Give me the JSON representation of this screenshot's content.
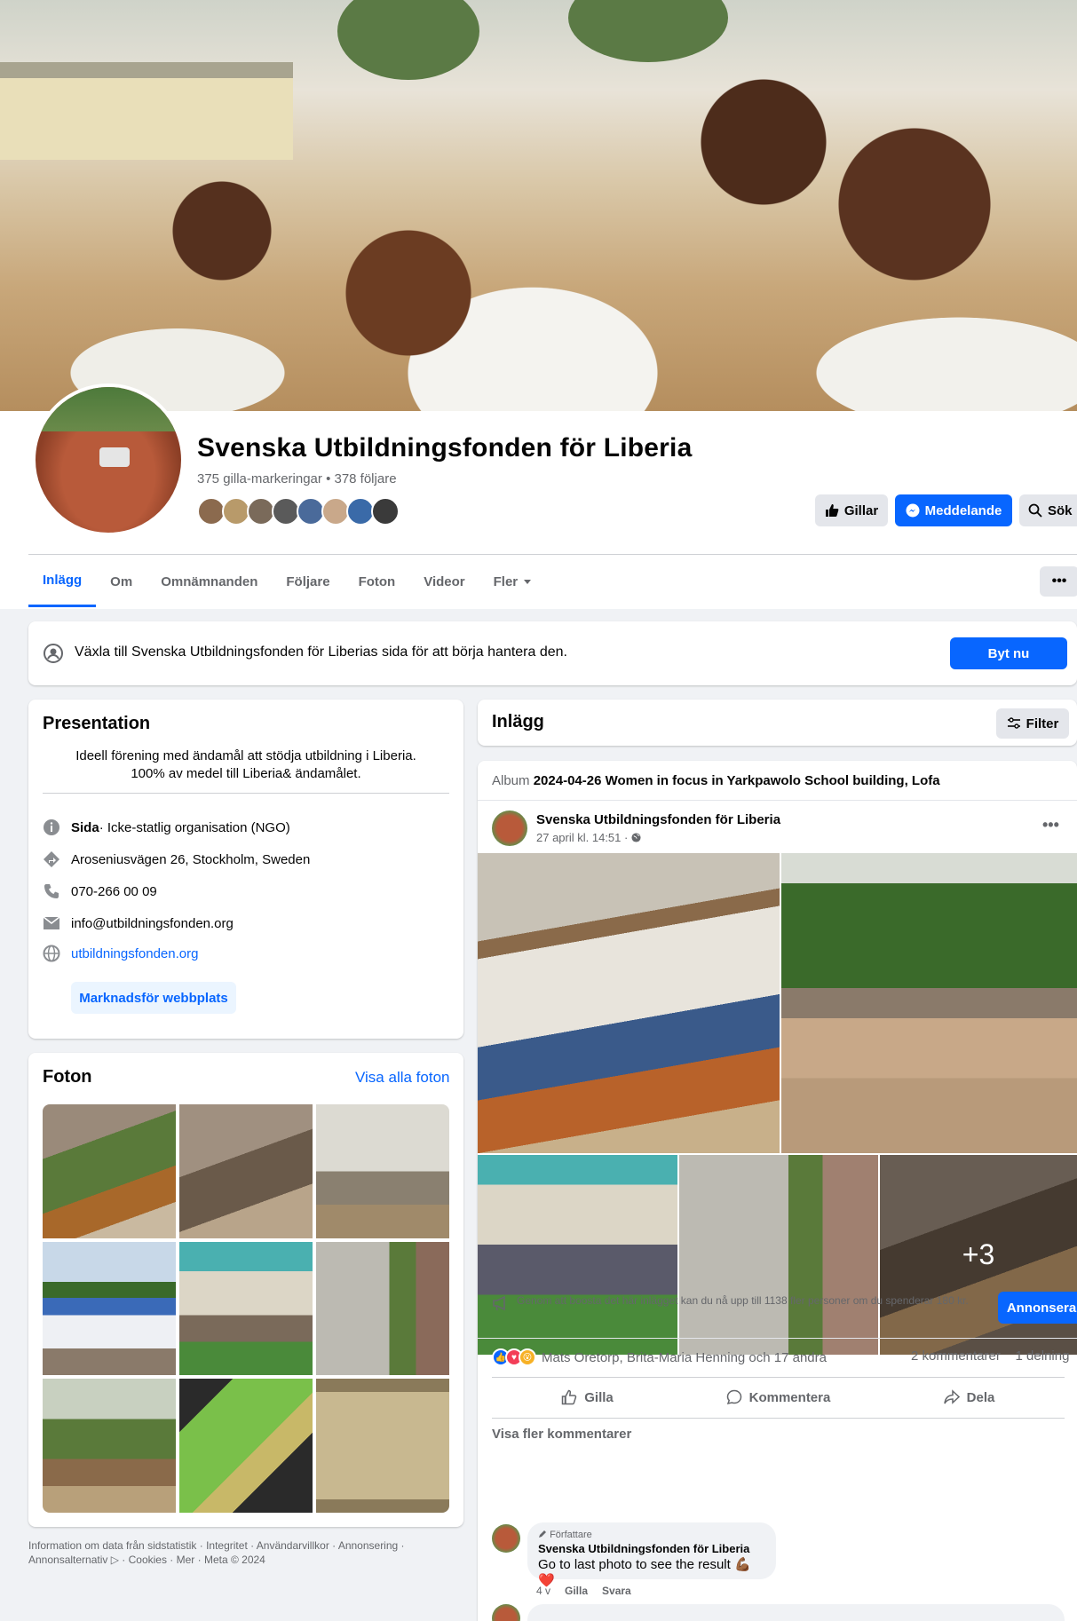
{
  "page": {
    "name": "Svenska Utbildningsfonden för Liberia",
    "stats": "375 gilla-markeringar • 378 följare"
  },
  "header_buttons": {
    "like": "Gillar",
    "message": "Meddelande",
    "search": "Sök"
  },
  "tabs": [
    "Inlägg",
    "Om",
    "Omnämnanden",
    "Följare",
    "Foton",
    "Videor",
    "Fler"
  ],
  "switch_banner": {
    "text": "Växla till Svenska Utbildningsfonden för Liberias sida för att börja hantera den.",
    "button": "Byt nu"
  },
  "presentation": {
    "title": "Presentation",
    "description_line1": "Ideell förening med ändamål att stödja utbildning i Liberia.",
    "description_line2": "100% av medel till Liberia& ändamålet.",
    "category_label": "Sida",
    "category_value": " · Icke-statlig organisation (NGO)",
    "address": "Aroseniusvägen 26, Stockholm, Sweden",
    "phone": "070-266 00 09",
    "email": "info@utbildningsfonden.org",
    "website": "utbildningsfonden.org",
    "promote_button": "Marknadsför webbplats"
  },
  "photos_card": {
    "title": "Foton",
    "link": "Visa alla foton"
  },
  "footer": {
    "line1": "Information om data från sidstatistik · Integritet · Användarvillkor · Annonsering ·",
    "line2": "Annonsalternativ ▷ · Cookies · Mer · Meta © 2024"
  },
  "posts_section": {
    "title": "Inlägg",
    "filter": "Filter"
  },
  "post": {
    "album_prefix": "Album",
    "album_title": "2024-04-26 Women in focus in Yarkpawolo School building, Lofa",
    "author": "Svenska Utbildningsfonden för Liberia",
    "time": "27 april kl. 14:51 · ",
    "more_count": "+3",
    "boost_text": "Genom att boosta det här inlägget kan du nå upp till 1138 fler personer om du spenderar 180 kr.",
    "boost_button": "Annonsera",
    "reactions_text": "Mats Oretorp, Brita-Maria Henning och 17 andra",
    "comments_count": "2 kommentarer",
    "shares_count": "1 delning",
    "action_like": "Gilla",
    "action_comment": "Kommentera",
    "action_share": "Dela",
    "more_comments": "Visa fler kommentarer"
  },
  "comment": {
    "badge": "Författare",
    "author": "Svenska Utbildningsfonden för Liberia",
    "text": "Go to last photo to see the result 💪🏾❤️",
    "age": "4 v",
    "like": "Gilla",
    "reply": "Svara"
  },
  "colors": {
    "accent": "#0866ff",
    "text_secondary": "#65676b",
    "background": "#f0f2f5"
  }
}
